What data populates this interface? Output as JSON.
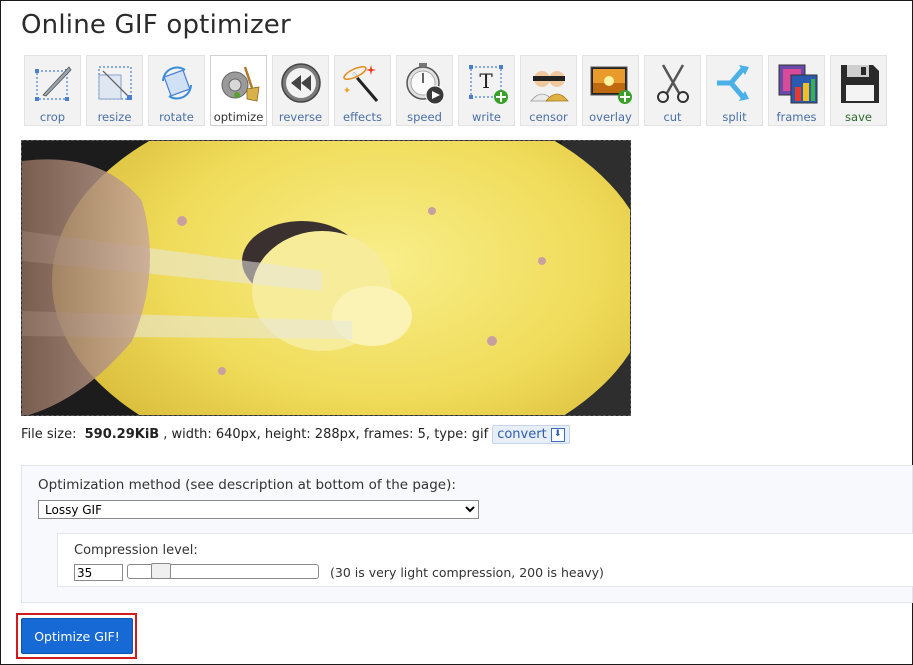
{
  "page": {
    "title": "Online GIF optimizer"
  },
  "toolbar": {
    "items": [
      {
        "label": "crop",
        "icon": "crop-icon"
      },
      {
        "label": "resize",
        "icon": "resize-icon"
      },
      {
        "label": "rotate",
        "icon": "rotate-icon"
      },
      {
        "label": "optimize",
        "icon": "optimize-broom-icon",
        "active": true
      },
      {
        "label": "reverse",
        "icon": "reverse-icon"
      },
      {
        "label": "effects",
        "icon": "effects-wand-icon"
      },
      {
        "label": "speed",
        "icon": "speed-stopwatch-icon"
      },
      {
        "label": "write",
        "icon": "write-text-icon"
      },
      {
        "label": "censor",
        "icon": "censor-icon"
      },
      {
        "label": "overlay",
        "icon": "overlay-icon"
      },
      {
        "label": "cut",
        "icon": "scissors-icon"
      },
      {
        "label": "split",
        "icon": "split-icon"
      },
      {
        "label": "frames",
        "icon": "frames-icon"
      },
      {
        "label": "save",
        "icon": "floppy-save-icon"
      }
    ]
  },
  "fileinfo": {
    "prefix": "File size: ",
    "size": "590.29KiB",
    "rest": ", width: 640px, height: 288px, frames: 5, type: gif",
    "convert_label": "convert"
  },
  "options": {
    "method_label": "Optimization method (see description at bottom of the page):",
    "method_selected": "Lossy GIF",
    "compression_label": "Compression level:",
    "compression_value": "35",
    "compression_slider_fraction": 0.03,
    "compression_hint": "(30 is very light compression, 200 is heavy)"
  },
  "actions": {
    "optimize_label": "Optimize GIF!"
  },
  "colors": {
    "accent": "#1769d6",
    "highlight": "#d41b1b",
    "link": "#4a6fa5"
  }
}
